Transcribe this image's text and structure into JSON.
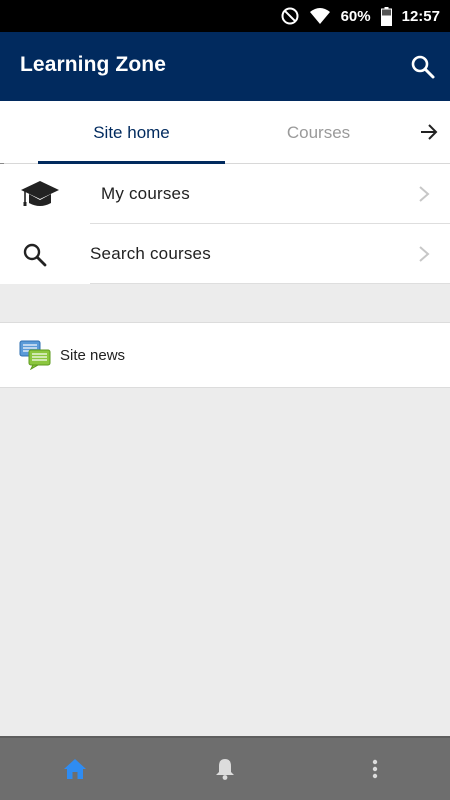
{
  "status_bar": {
    "battery": "60%",
    "time": "12:57"
  },
  "app_bar": {
    "title": "Learning Zone"
  },
  "tabs": [
    {
      "label": "Site home",
      "active": true
    },
    {
      "label": "Courses",
      "active": false
    }
  ],
  "menu": {
    "items": [
      {
        "label": "My courses",
        "icon": "graduation-cap-icon"
      },
      {
        "label": "Search courses",
        "icon": "search-icon"
      }
    ]
  },
  "news": {
    "label": "Site news",
    "icon": "forum-chat-icon"
  },
  "bottom_nav": {
    "items": [
      {
        "icon": "home-icon",
        "active": true
      },
      {
        "icon": "bell-icon",
        "active": false
      },
      {
        "icon": "more-vertical-icon",
        "active": false
      }
    ]
  },
  "colors": {
    "brand": "#012a5e",
    "active_nav": "#2f8cf2",
    "page_bg": "#ececec",
    "bottom_nav_bg": "#6e6e6e"
  }
}
